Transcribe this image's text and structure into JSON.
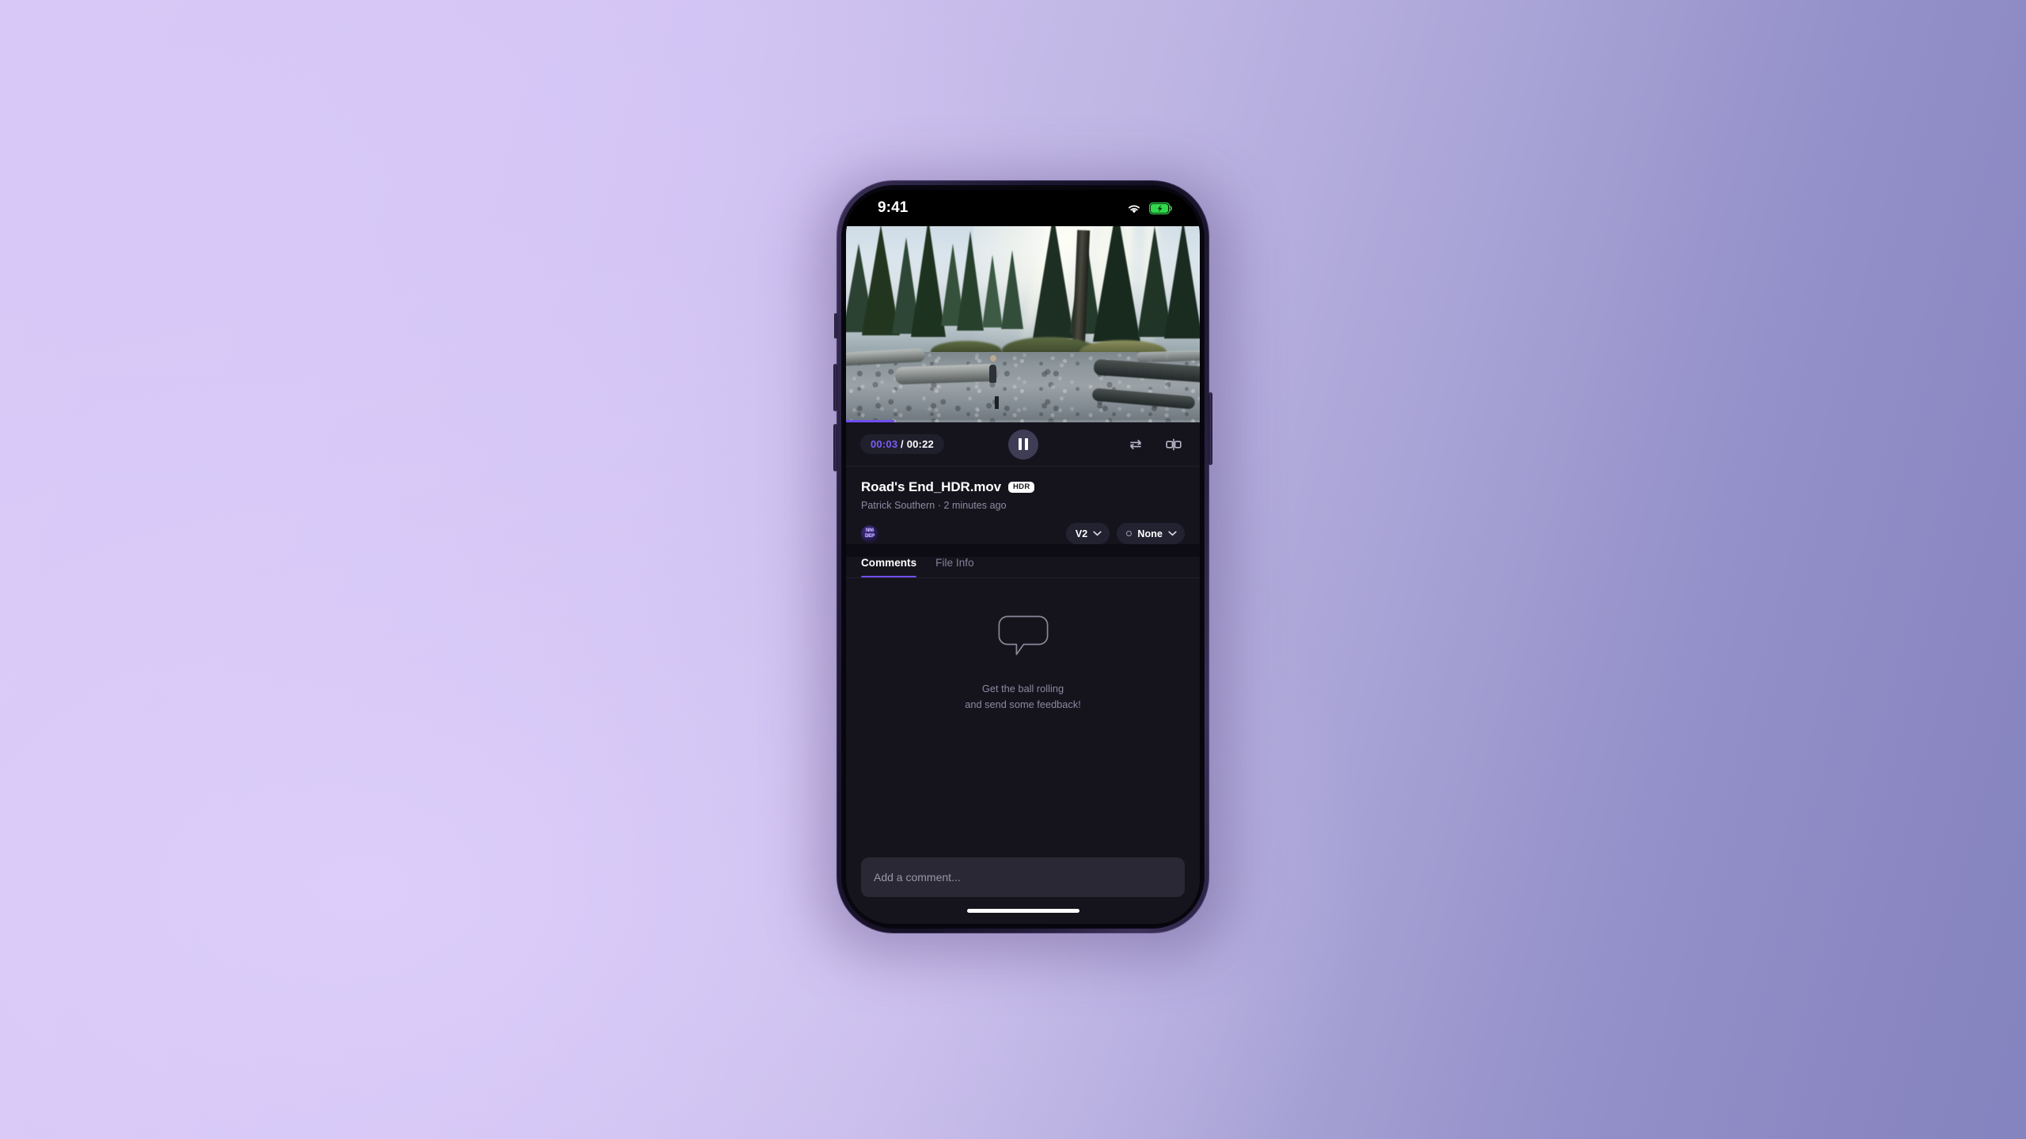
{
  "background": {
    "gradient_from": "#d8c9f7",
    "gradient_to": "#8584bf"
  },
  "device": {
    "frame_color": "#2c2444",
    "screen_background": "#15141d"
  },
  "status_bar": {
    "time": "9:41",
    "wifi_icon": "wifi-icon",
    "battery_icon": "battery-charging-icon",
    "battery_state": "charging",
    "battery_color": "#32d74b"
  },
  "player": {
    "scene_description": "Forest with sunbeams, person on rocky riverbed",
    "progress_percent": 13.6,
    "progress_color": "#6f4ff0",
    "current_time": "00:03",
    "time_separator": "/",
    "duration": "00:22",
    "playpause_icon": "pause-icon",
    "playpause_state": "playing",
    "loop_icon": "loop-icon",
    "compare_icon": "compare-split-icon"
  },
  "file": {
    "name": "Road's End_HDR.mov",
    "badge": "HDR",
    "author": "Patrick Southern",
    "separator": "·",
    "uploaded": "2 minutes ago",
    "byline": "Patrick Southern · 2 minutes ago",
    "avatar_icon": "workspace-avatar",
    "avatar_line1": "NN\\",
    "avatar_line2": "DEP"
  },
  "selectors": [
    {
      "label": "V2",
      "has_dot": false,
      "chevron_icon": "chevron-down-icon"
    },
    {
      "label": "None",
      "has_dot": true,
      "chevron_icon": "chevron-down-icon"
    }
  ],
  "tabs": [
    {
      "label": "Comments",
      "active": true
    },
    {
      "label": "File Info",
      "active": false
    }
  ],
  "comments_empty_state": {
    "icon": "speech-bubble-icon",
    "line1": "Get the ball rolling",
    "line2": "and send some feedback!"
  },
  "composer": {
    "placeholder": "Add a comment...",
    "value": ""
  },
  "home_indicator": {
    "name": "home-indicator"
  },
  "accent_color": "#6f4ff0"
}
